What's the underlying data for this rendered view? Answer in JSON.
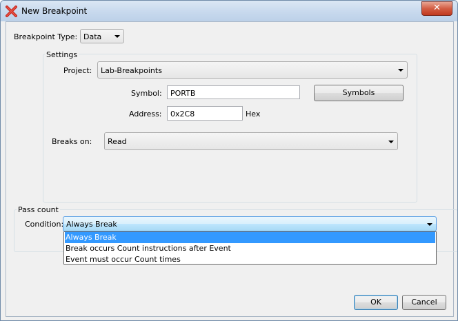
{
  "window": {
    "title": "New Breakpoint",
    "close_glyph": "✕"
  },
  "breakpoint_type": {
    "label": "Breakpoint Type:",
    "value": "Data"
  },
  "settings": {
    "title": "Settings",
    "project_label": "Project:",
    "project_value": "Lab-Breakpoints",
    "symbol_label": "Symbol:",
    "symbol_value": "PORTB",
    "symbols_button": "Symbols",
    "address_label": "Address:",
    "address_value": "0x2C8",
    "address_suffix": "Hex",
    "breaks_on_label": "Breaks on:",
    "breaks_on_value": "Read"
  },
  "pass_count": {
    "title": "Pass count",
    "condition_label": "Condition:",
    "condition_value": "Always Break",
    "options": [
      "Always Break",
      "Break occurs Count instructions after Event",
      "Event must occur Count times"
    ],
    "selected_index": 0
  },
  "buttons": {
    "ok": "OK",
    "cancel": "Cancel"
  },
  "colors": {
    "selection": "#3399ff",
    "titlebar": "#c9daee",
    "dialog_bg": "#f0f0f0"
  },
  "icons": {
    "app": "red-x-icon"
  }
}
